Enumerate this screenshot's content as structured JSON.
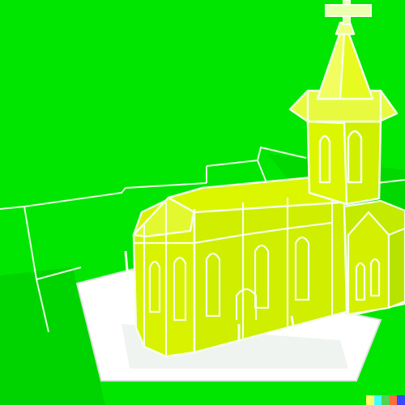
{
  "scene": {
    "colors": {
      "background": "#00e600",
      "background_dark": "#00c400",
      "church_light": "#dcf500",
      "church_mid": "#c8ec00",
      "church_dark": "#a8dc00",
      "outline": "#f4ffe8",
      "base": "#ffffff"
    }
  },
  "watermark": {
    "colors": [
      "#ffff66",
      "#42ffff",
      "#52d252",
      "#ff6e3c",
      "#3c46ff"
    ]
  }
}
